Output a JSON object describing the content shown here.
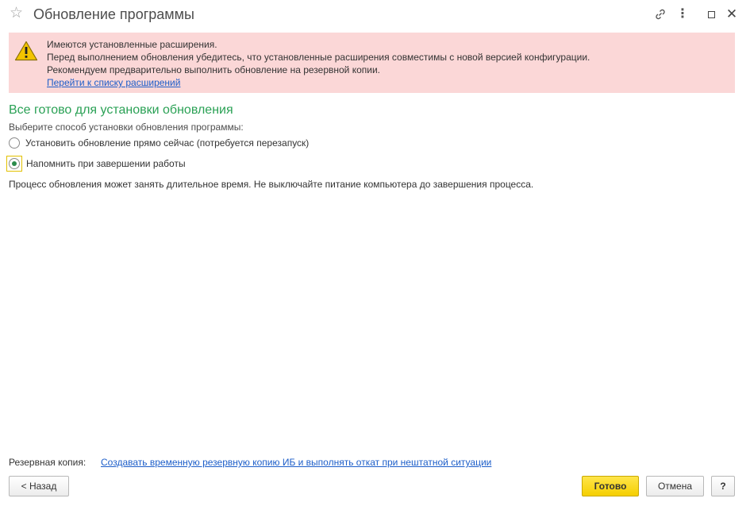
{
  "window": {
    "title": "Обновление программы",
    "icons": [
      "star-icon",
      "link-icon",
      "more-icon",
      "maximize-icon",
      "close-icon"
    ]
  },
  "warning": {
    "icon": "warning-icon",
    "line1": "Имеются установленные расширения.",
    "line2": "Перед выполнением обновления убедитесь, что установленные расширения совместимы с новой версией конфигурации.",
    "line3": "Рекомендуем предварительно выполнить обновление на резервной копии.",
    "link": "Перейти к списку расширений"
  },
  "main": {
    "heading": "Все готово для установки обновления",
    "subtitle": "Выберите способ установки обновления программы:",
    "options": [
      {
        "label": "Установить обновление прямо сейчас (потребуется перезапуск)",
        "selected": false
      },
      {
        "label": "Напомнить при завершении работы",
        "selected": true
      }
    ],
    "note": "Процесс обновления может занять длительное время. Не выключайте питание компьютера до завершения процесса."
  },
  "backup": {
    "label": "Резервная копия:",
    "link": "Создавать временную резервную копию ИБ и выполнять откат при нештатной ситуации"
  },
  "buttons": {
    "back": "< Назад",
    "done": "Готово",
    "cancel": "Отмена",
    "help": "?"
  },
  "colors": {
    "heading": "#2aa155",
    "warning_bg": "#fbd7d7",
    "link": "#1d5ec9",
    "primary_button": "#f5cf00"
  }
}
